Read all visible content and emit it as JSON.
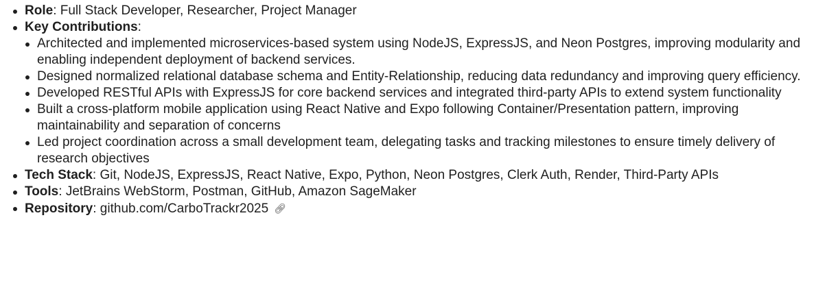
{
  "items": {
    "role": {
      "label": "Role",
      "sep": ":",
      "text": " Full Stack Developer, Researcher, Project Manager"
    },
    "contributions": {
      "label": "Key Contributions",
      "sep": ":",
      "bullets": [
        "Architected and implemented microservices-based system using NodeJS, ExpressJS, and Neon Postgres, improving modularity and enabling independent deployment of backend services.",
        "Designed normalized relational database schema and Entity-Relationship, reducing data redundancy and improving query efficiency.",
        "Developed RESTful APIs with ExpressJS for core backend services and integrated third-party APIs to extend system functionality",
        "Built a cross-platform mobile application using React Native and Expo following Container/Presentation pattern, improving maintainability and separation of concerns",
        "Led project coordination across a small development team, delegating tasks and tracking milestones to ensure timely delivery of research objectives"
      ]
    },
    "tech": {
      "label": "Tech Stack",
      "sep": ":",
      "text": " Git, NodeJS, ExpressJS, React Native, Expo, Python, Neon Postgres, Clerk Auth, Render, Third-Party APIs"
    },
    "tools": {
      "label": "Tools",
      "sep": ":",
      "text": " JetBrains WebStorm, Postman, GitHub, Amazon SageMaker"
    },
    "repo": {
      "label": "Repository",
      "sep": ":",
      "text": " github.com/CarboTrackr2025",
      "icon": "link-icon"
    }
  }
}
